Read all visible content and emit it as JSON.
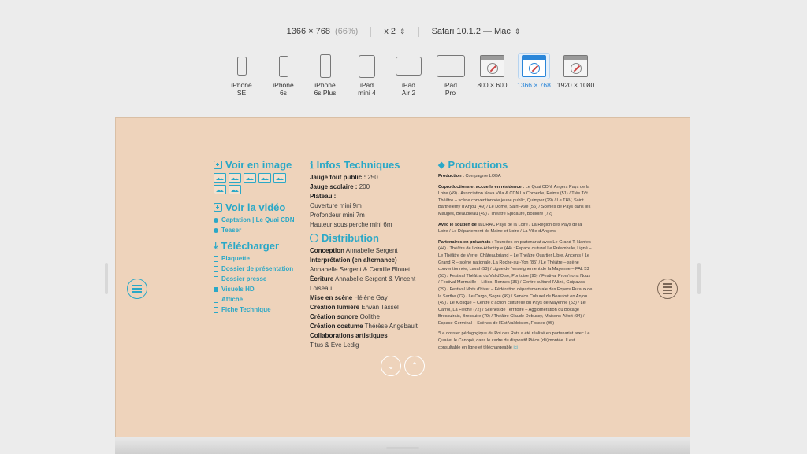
{
  "toolbar": {
    "resolution": "1366 × 768",
    "zoom": "(66%)",
    "scale": "x 2",
    "browser": "Safari 10.1.2 — Mac"
  },
  "devices": [
    {
      "line1": "iPhone",
      "line2": "SE",
      "kind": "phone",
      "w": 12,
      "h": 24
    },
    {
      "line1": "iPhone",
      "line2": "6s",
      "kind": "phone",
      "w": 12,
      "h": 27
    },
    {
      "line1": "iPhone",
      "line2": "6s Plus",
      "kind": "phone",
      "w": 14,
      "h": 30
    },
    {
      "line1": "iPad",
      "line2": "mini 4",
      "kind": "tablet",
      "w": 21,
      "h": 29
    },
    {
      "line1": "iPad",
      "line2": "Air 2",
      "kind": "tablet",
      "w": 33,
      "h": 24
    },
    {
      "line1": "iPad",
      "line2": "Pro",
      "kind": "tablet",
      "w": 36,
      "h": 28
    },
    {
      "line1": "800 × 600",
      "line2": "",
      "kind": "screen"
    },
    {
      "line1": "1366 × 768",
      "line2": "",
      "kind": "screen",
      "active": true
    },
    {
      "line1": "1920 × 1080",
      "line2": "",
      "kind": "screen"
    }
  ],
  "col1": {
    "voir_image": "Voir en image",
    "voir_video": "Voir la vidéo",
    "video_links": [
      "Captation | Le Quai CDN",
      "Teaser"
    ],
    "telecharger": "Télécharger",
    "downloads": [
      {
        "label": "Plaquette",
        "icon": "doc"
      },
      {
        "label": "Dossier de présentation",
        "icon": "doc"
      },
      {
        "label": "Dossier presse",
        "icon": "doc"
      },
      {
        "label": "Visuels HD",
        "icon": "lock"
      },
      {
        "label": "Affiche",
        "icon": "doc"
      },
      {
        "label": "Fiche Technique",
        "icon": "doc"
      }
    ]
  },
  "col2": {
    "infos_title": "Infos Techniques",
    "infos": [
      {
        "k": "Jauge tout public :",
        "v": " 250"
      },
      {
        "k": "Jauge scolaire :",
        "v": " 200"
      },
      {
        "k": "Plateau :",
        "v": ""
      },
      {
        "k": "",
        "v": "Ouverture mini 9m"
      },
      {
        "k": "",
        "v": "Profondeur mini 7m"
      },
      {
        "k": "",
        "v": "Hauteur sous perche mini 6m"
      }
    ],
    "distribution_title": "Distribution",
    "distribution": [
      {
        "k": "Conception",
        "v": " Annabelle Sergent"
      },
      {
        "k": "Interprétation (en alternance)",
        "v": ""
      },
      {
        "k": "",
        "v": "Annabelle Sergent & Camille Blouet"
      },
      {
        "k": "Écriture",
        "v": " Annabelle Sergent & Vincent"
      },
      {
        "k": "",
        "v": "Loiseau"
      },
      {
        "k": "Mise en scène",
        "v": " Hélène Gay"
      },
      {
        "k": "Création lumière",
        "v": " Erwan Tassel"
      },
      {
        "k": "Création sonore",
        "v": " Oolithe"
      },
      {
        "k": "Création costume",
        "v": " Thérèse Angebault"
      },
      {
        "k": "Collaborations artistiques",
        "v": ""
      },
      {
        "k": "",
        "v": "Titus & Eve Ledig"
      }
    ]
  },
  "col3": {
    "title": "Productions",
    "production_k": "Production :",
    "production_v": " Compagnie LOBA",
    "copro_k": "Coproductions et accueils en résidence :",
    "copro_v": " Le Quai CDN, Angers Pays de la Loire (49) / Association Nova Villa & CDN La Comédie, Reims (51) / Très Tôt Théâtre – scène conventionnée jeune public, Quimper (29) / Le THV, Saint Barthélémy d'Anjou (49) / Le Dôme, Saint-Avé (56) / Scènes de Pays dans les Mauges, Beaupréau (49) / Théâtre Epidaure, Bouloire (72)",
    "soutien_k": "Avec le soutien de",
    "soutien_v": " la DRAC Pays de la Loire / La Région des Pays de la Loire / Le Département de Maine-et-Loire / La Ville d'Angers",
    "partenaires_k": "Partenaires en préachats :",
    "partenaires_v": " Tournées en partenariat avec Le Grand T, Nantes (44) / Théâtre de Loire-Atlantique (44) : Espace culturel Le Préambule, Ligné – Le Théâtre de Verre, Châteaubriand – Le Théâtre Quartier Libre, Ancenis / Le Grand R – scène nationale, La Roche-sur-Yon (85) / Le Théâtre – scène conventionnée, Laval (53) / Ligue de l'enseignement de la Mayenne – FAL 53 (53) / Festival Théâtral du Val d'Oise, Pontoise (95) / Festival Prom'nons Nous / Festival Marmaille – Lillico, Rennes (35) / Centre culturel l'Alizé, Guipavas (29) / Festival Mots d'hiver – Fédération départementale des Foyers Ruraux de la Sarthe (72) / Le Cargo, Segré (49) / Service Culturel de Beaufort en Anjou (49) / Le Kiosque – Centre d'action culturelle du Pays de Mayenne (53) / Le Carroi, La Flèche (72) / Scènes de Territoire – Agglomération du Bocage Bressuirais, Bressuire (79) / Théâtre Claude Debussy, Maisons-Alfort (94) / Espace Germinal – Scènes de l'Est Valdoisien, Fosses (95)",
    "note": "*Le dossier pédagogique du Roi des Rats a été réalisé en partenariat avec Le Quai et le Canopé, dans le cadre du dispositif Pièce (dé)montée. Il est consultable en ligne et téléchargeable ",
    "note_link": "ici"
  },
  "colors": {
    "accent": "#2aa8c7",
    "page_bg": "#eed3bb",
    "active_device": "#2a86d9"
  }
}
